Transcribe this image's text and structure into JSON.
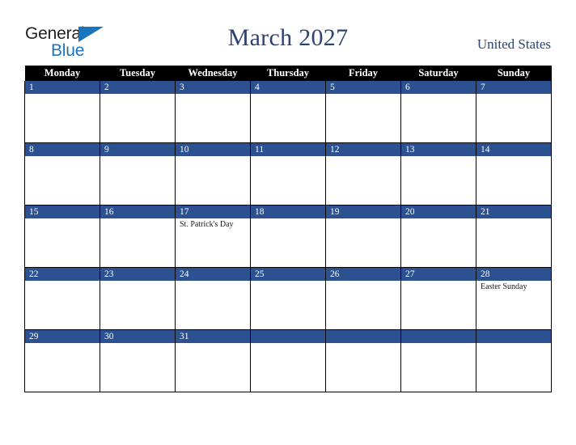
{
  "brand": {
    "name_part1": "General",
    "name_part2": "Blue",
    "triangle_icon": "triangle-icon",
    "color_dark": "#231f20",
    "color_blue": "#1b75bc"
  },
  "header": {
    "title": "March 2027",
    "country": "United States",
    "title_color": "#2e4372"
  },
  "calendar": {
    "month": "March",
    "year": "2027",
    "header_bg": "#000000",
    "daybar_bg": "#2c5191",
    "daybar_text": "#ffffff",
    "weekdays": [
      "Monday",
      "Tuesday",
      "Wednesday",
      "Thursday",
      "Friday",
      "Saturday",
      "Sunday"
    ],
    "weeks": [
      [
        {
          "day": "1",
          "events": []
        },
        {
          "day": "2",
          "events": []
        },
        {
          "day": "3",
          "events": []
        },
        {
          "day": "4",
          "events": []
        },
        {
          "day": "5",
          "events": []
        },
        {
          "day": "6",
          "events": []
        },
        {
          "day": "7",
          "events": []
        }
      ],
      [
        {
          "day": "8",
          "events": []
        },
        {
          "day": "9",
          "events": []
        },
        {
          "day": "10",
          "events": []
        },
        {
          "day": "11",
          "events": []
        },
        {
          "day": "12",
          "events": []
        },
        {
          "day": "13",
          "events": []
        },
        {
          "day": "14",
          "events": []
        }
      ],
      [
        {
          "day": "15",
          "events": []
        },
        {
          "day": "16",
          "events": []
        },
        {
          "day": "17",
          "events": [
            "St. Patrick's Day"
          ]
        },
        {
          "day": "18",
          "events": []
        },
        {
          "day": "19",
          "events": []
        },
        {
          "day": "20",
          "events": []
        },
        {
          "day": "21",
          "events": []
        }
      ],
      [
        {
          "day": "22",
          "events": []
        },
        {
          "day": "23",
          "events": []
        },
        {
          "day": "24",
          "events": []
        },
        {
          "day": "25",
          "events": []
        },
        {
          "day": "26",
          "events": []
        },
        {
          "day": "27",
          "events": []
        },
        {
          "day": "28",
          "events": [
            "Easter Sunday"
          ]
        }
      ],
      [
        {
          "day": "29",
          "events": []
        },
        {
          "day": "30",
          "events": []
        },
        {
          "day": "31",
          "events": []
        },
        {
          "day": "",
          "events": []
        },
        {
          "day": "",
          "events": []
        },
        {
          "day": "",
          "events": []
        },
        {
          "day": "",
          "events": []
        }
      ]
    ]
  }
}
